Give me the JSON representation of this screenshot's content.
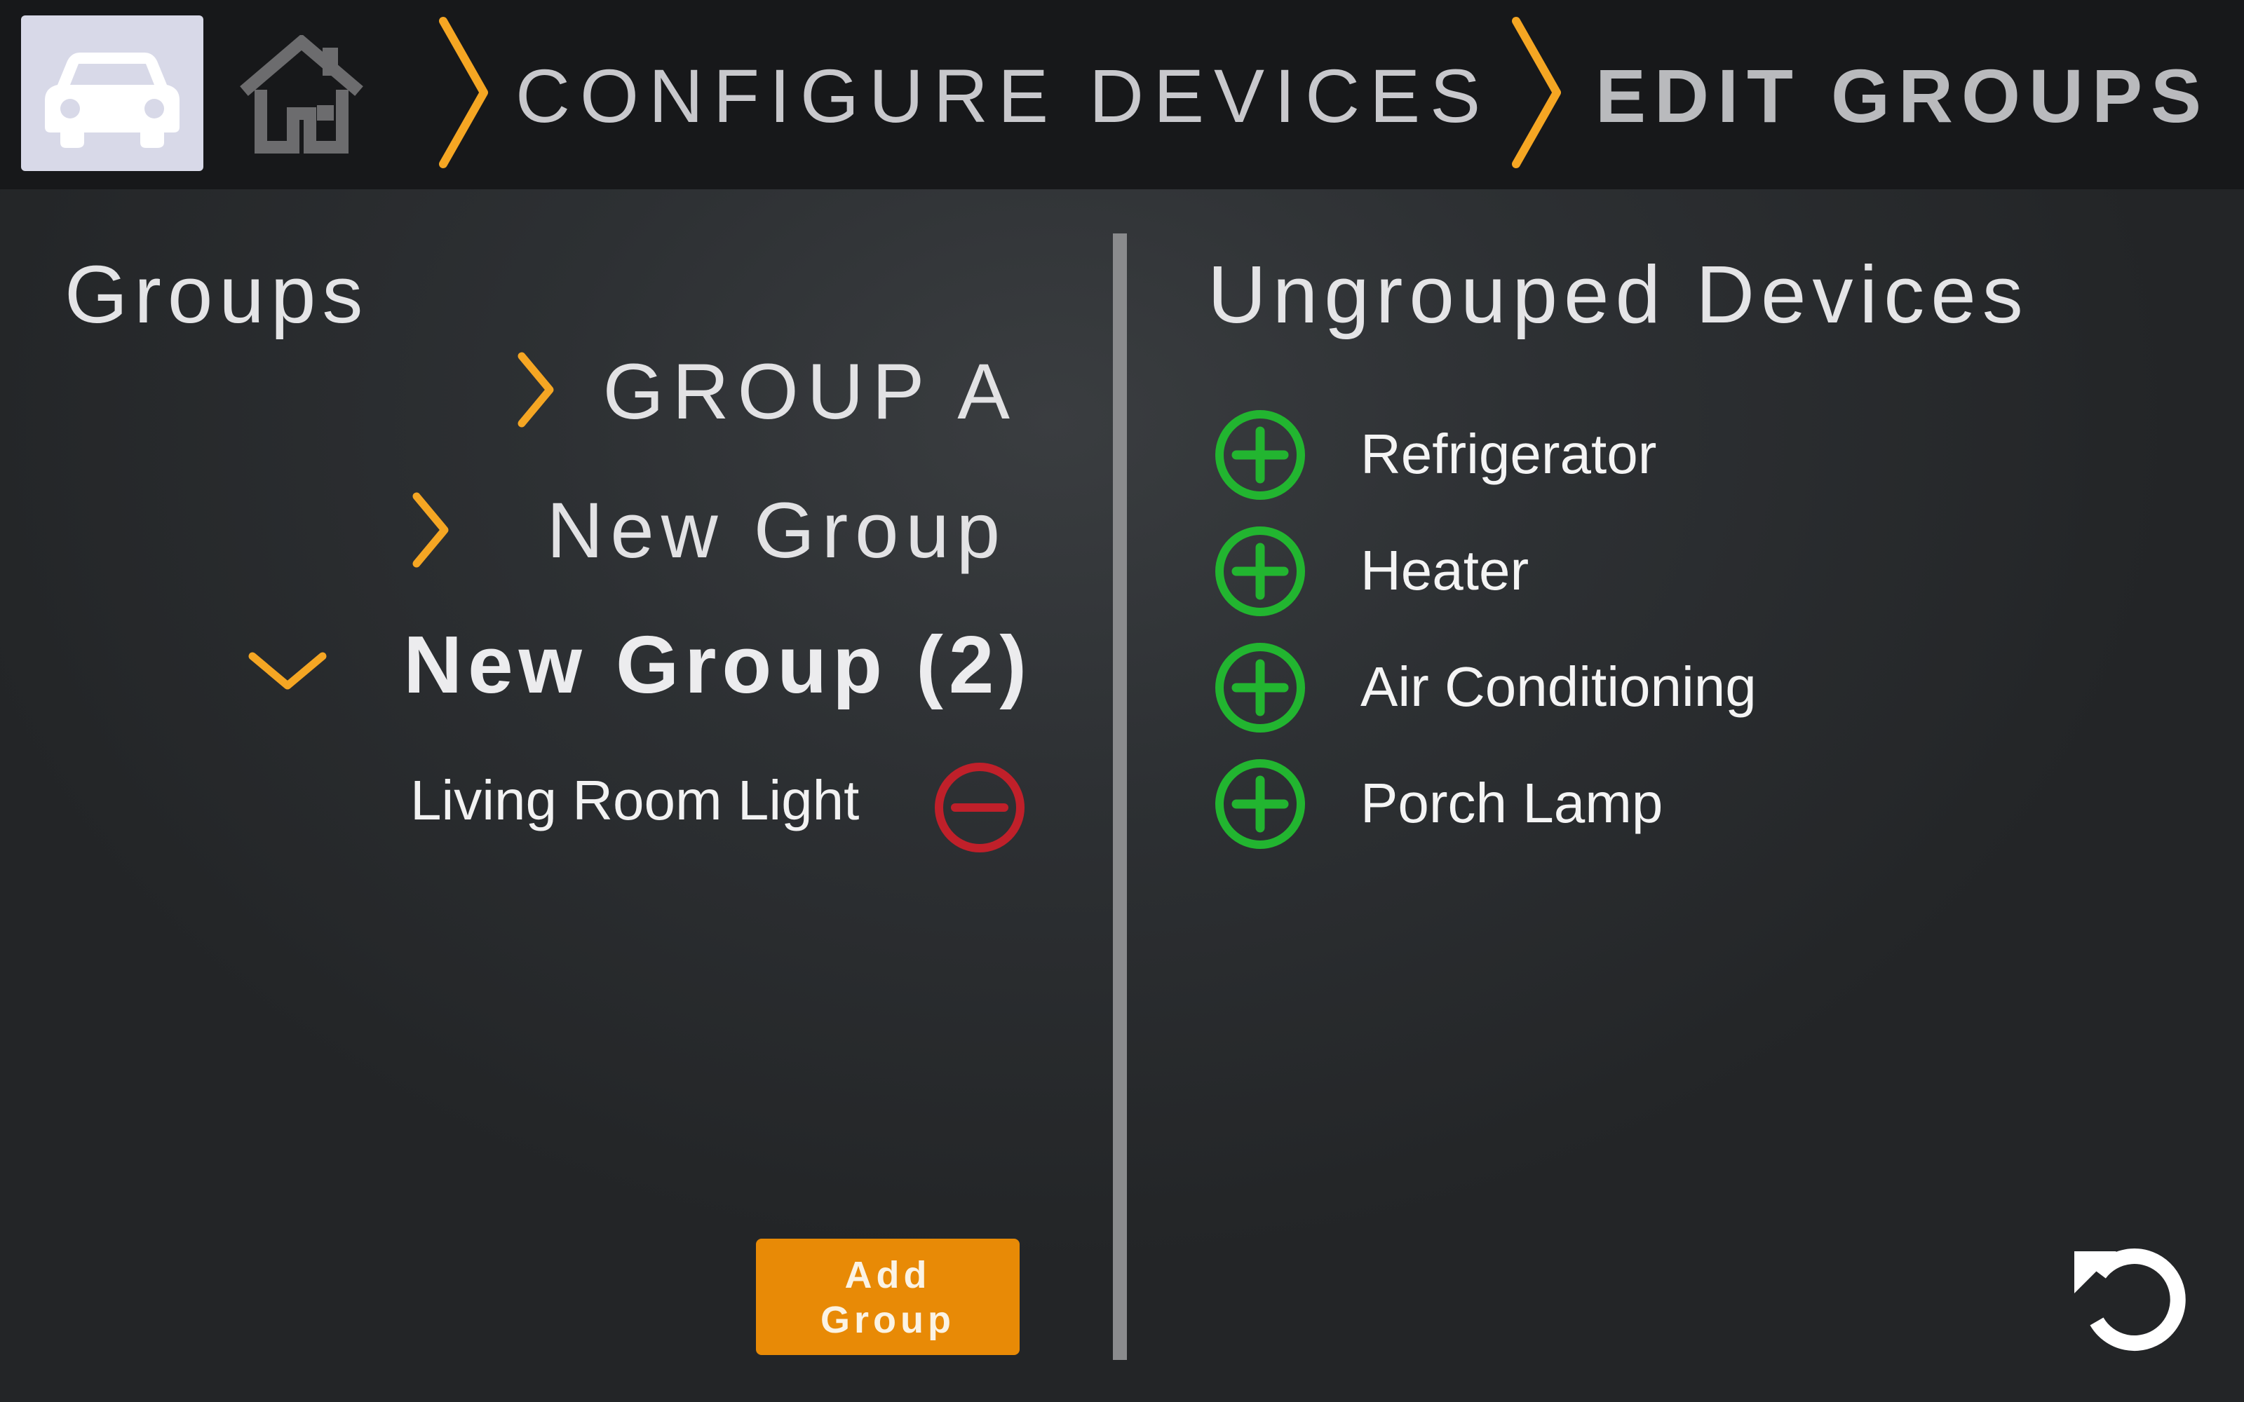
{
  "header": {
    "breadcrumbs": [
      {
        "label": "CONFIGURE DEVICES"
      },
      {
        "label": "EDIT GROUPS"
      }
    ],
    "car_icon": "car-icon",
    "home_icon": "home-icon",
    "chevron_icon": "chevron-right-icon"
  },
  "groups_panel": {
    "title": "Groups",
    "groups": [
      {
        "label": "GROUP A",
        "expanded": false
      },
      {
        "label": "New Group",
        "expanded": false
      },
      {
        "label": "New Group (2)",
        "expanded": true,
        "members": [
          {
            "label": "Living Room Light",
            "action_icon": "remove-circle-icon"
          }
        ]
      }
    ],
    "add_button": {
      "line1": "Add",
      "line2": "Group"
    }
  },
  "ungrouped_panel": {
    "title": "Ungrouped Devices",
    "devices": [
      {
        "label": "Refrigerator",
        "action_icon": "add-circle-icon"
      },
      {
        "label": "Heater",
        "action_icon": "add-circle-icon"
      },
      {
        "label": "Air Conditioning",
        "action_icon": "add-circle-icon"
      },
      {
        "label": "Porch Lamp",
        "action_icon": "add-circle-icon"
      }
    ]
  },
  "footer": {
    "undo_icon": "undo-icon"
  },
  "colors": {
    "accent": "#f5a623",
    "add_green": "#22b530",
    "remove_red": "#c0202a",
    "button_orange": "#e88a06",
    "header_bg": "#17181a"
  }
}
